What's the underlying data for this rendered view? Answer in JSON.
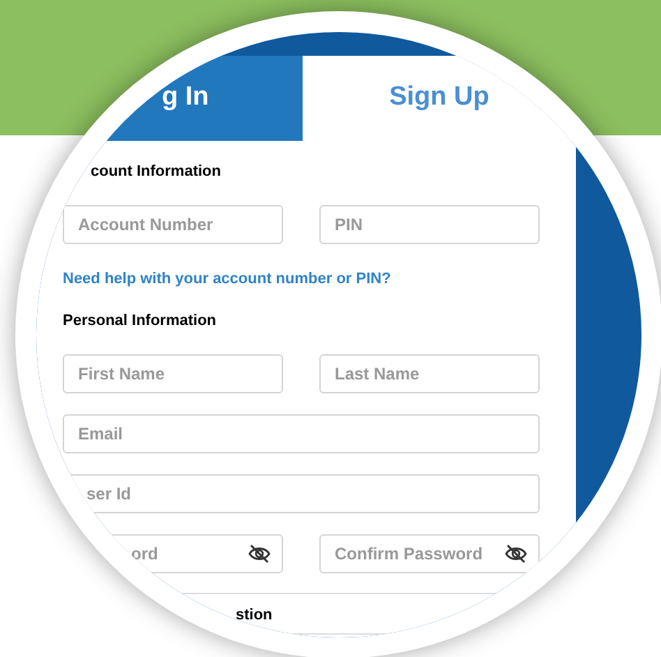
{
  "tabs": [
    {
      "label": "g In",
      "selected": false
    },
    {
      "label": "Sign Up",
      "selected": true
    }
  ],
  "account_section": {
    "heading": "count Information",
    "fields": [
      {
        "placeholder": "Account Number"
      },
      {
        "placeholder": "PIN"
      }
    ],
    "help_link": "Need help with your account number or PIN?"
  },
  "personal_section": {
    "heading": "Personal Information",
    "fields": [
      {
        "placeholder": "First Name",
        "kind": "half"
      },
      {
        "placeholder": "Last Name",
        "kind": "half"
      },
      {
        "placeholder": "Email",
        "kind": "full"
      },
      {
        "placeholder": "ser Id",
        "kind": "full"
      },
      {
        "placeholder": "ord",
        "kind": "password"
      },
      {
        "placeholder": "Confirm Password",
        "kind": "password"
      }
    ]
  },
  "security_section": {
    "heading": "stion"
  }
}
